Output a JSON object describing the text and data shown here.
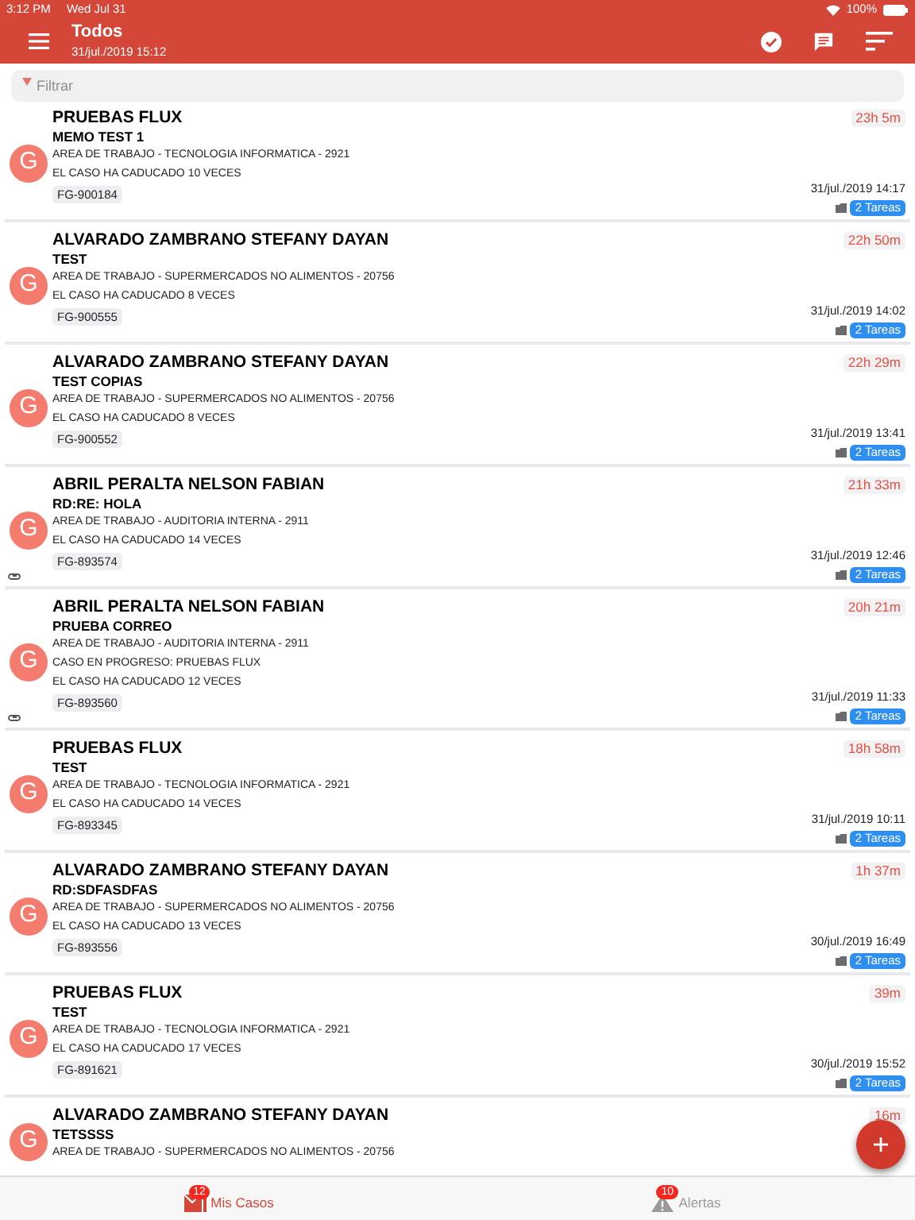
{
  "status_bar": {
    "time": "3:12 PM",
    "date": "Wed Jul 31",
    "battery": "100%"
  },
  "header": {
    "title": "Todos",
    "subtitle": "31/jul./2019 15:12"
  },
  "filter": {
    "placeholder": "Filtrar"
  },
  "cases": [
    {
      "avatar": "G",
      "name": "PRUEBAS FLUX",
      "subject": "MEMO TEST 1",
      "lines": [
        "AREA DE TRABAJO - TECNOLOGIA INFORMATICA - 2921",
        "EL CASO HA CADUCADO 10 VECES"
      ],
      "code": "FG-900184",
      "elapsed": "23h 5m",
      "date": "31/jul./2019 14:17",
      "tasks": "2 Tareas",
      "attachment": false
    },
    {
      "avatar": "G",
      "name": "ALVARADO ZAMBRANO STEFANY DAYAN",
      "subject": "TEST",
      "lines": [
        "AREA DE TRABAJO - SUPERMERCADOS NO ALIMENTOS - 20756",
        "EL CASO HA CADUCADO 8 VECES"
      ],
      "code": "FG-900555",
      "elapsed": "22h 50m",
      "date": "31/jul./2019 14:02",
      "tasks": "2 Tareas",
      "attachment": false
    },
    {
      "avatar": "G",
      "name": "ALVARADO ZAMBRANO STEFANY DAYAN",
      "subject": "TEST COPIAS",
      "lines": [
        "AREA DE TRABAJO - SUPERMERCADOS NO ALIMENTOS - 20756",
        "EL CASO HA CADUCADO 8 VECES"
      ],
      "code": "FG-900552",
      "elapsed": "22h 29m",
      "date": "31/jul./2019 13:41",
      "tasks": "2 Tareas",
      "attachment": false
    },
    {
      "avatar": "G",
      "name": "ABRIL PERALTA NELSON FABIAN",
      "subject": "RD:RE: HOLA",
      "lines": [
        "AREA DE TRABAJO - AUDITORIA INTERNA - 2911",
        "EL CASO HA CADUCADO 14 VECES"
      ],
      "code": "FG-893574",
      "elapsed": "21h 33m",
      "date": "31/jul./2019 12:46",
      "tasks": "2 Tareas",
      "attachment": true
    },
    {
      "avatar": "G",
      "name": "ABRIL PERALTA NELSON FABIAN",
      "subject": "PRUEBA CORREO",
      "lines": [
        "AREA DE TRABAJO - AUDITORIA INTERNA - 2911",
        "CASO EN PROGRESO:  PRUEBAS FLUX",
        "EL CASO HA CADUCADO 12 VECES"
      ],
      "code": "FG-893560",
      "elapsed": "20h 21m",
      "date": "31/jul./2019 11:33",
      "tasks": "2 Tareas",
      "attachment": true
    },
    {
      "avatar": "G",
      "name": "PRUEBAS FLUX",
      "subject": "TEST",
      "lines": [
        "AREA DE TRABAJO - TECNOLOGIA INFORMATICA - 2921",
        "EL CASO HA CADUCADO 14 VECES"
      ],
      "code": "FG-893345",
      "elapsed": "18h 58m",
      "date": "31/jul./2019 10:11",
      "tasks": "2 Tareas",
      "attachment": false
    },
    {
      "avatar": "G",
      "name": "ALVARADO ZAMBRANO STEFANY DAYAN",
      "subject": "RD:SDFASDFAS",
      "lines": [
        "AREA DE TRABAJO - SUPERMERCADOS NO ALIMENTOS - 20756",
        "EL CASO HA CADUCADO 13 VECES"
      ],
      "code": "FG-893556",
      "elapsed": "1h 37m",
      "date": "30/jul./2019 16:49",
      "tasks": "2 Tareas",
      "attachment": false
    },
    {
      "avatar": "G",
      "name": "PRUEBAS FLUX",
      "subject": "TEST",
      "lines": [
        "AREA DE TRABAJO - TECNOLOGIA INFORMATICA - 2921",
        "EL CASO HA CADUCADO 17 VECES"
      ],
      "code": "FG-891621",
      "elapsed": "39m",
      "date": "30/jul./2019 15:52",
      "tasks": "2 Tareas",
      "attachment": false
    },
    {
      "avatar": "G",
      "name": "ALVARADO ZAMBRANO STEFANY DAYAN",
      "subject": "TETSSSS",
      "lines": [
        "AREA DE TRABAJO - SUPERMERCADOS NO ALIMENTOS - 20756"
      ],
      "elapsed": "16m",
      "attachment": false
    }
  ],
  "tabs": [
    {
      "label": "Mis Casos",
      "badge": "12",
      "selected": true,
      "kind": "cases"
    },
    {
      "label": "Alertas",
      "badge": "10",
      "selected": false,
      "kind": "alerts"
    }
  ]
}
